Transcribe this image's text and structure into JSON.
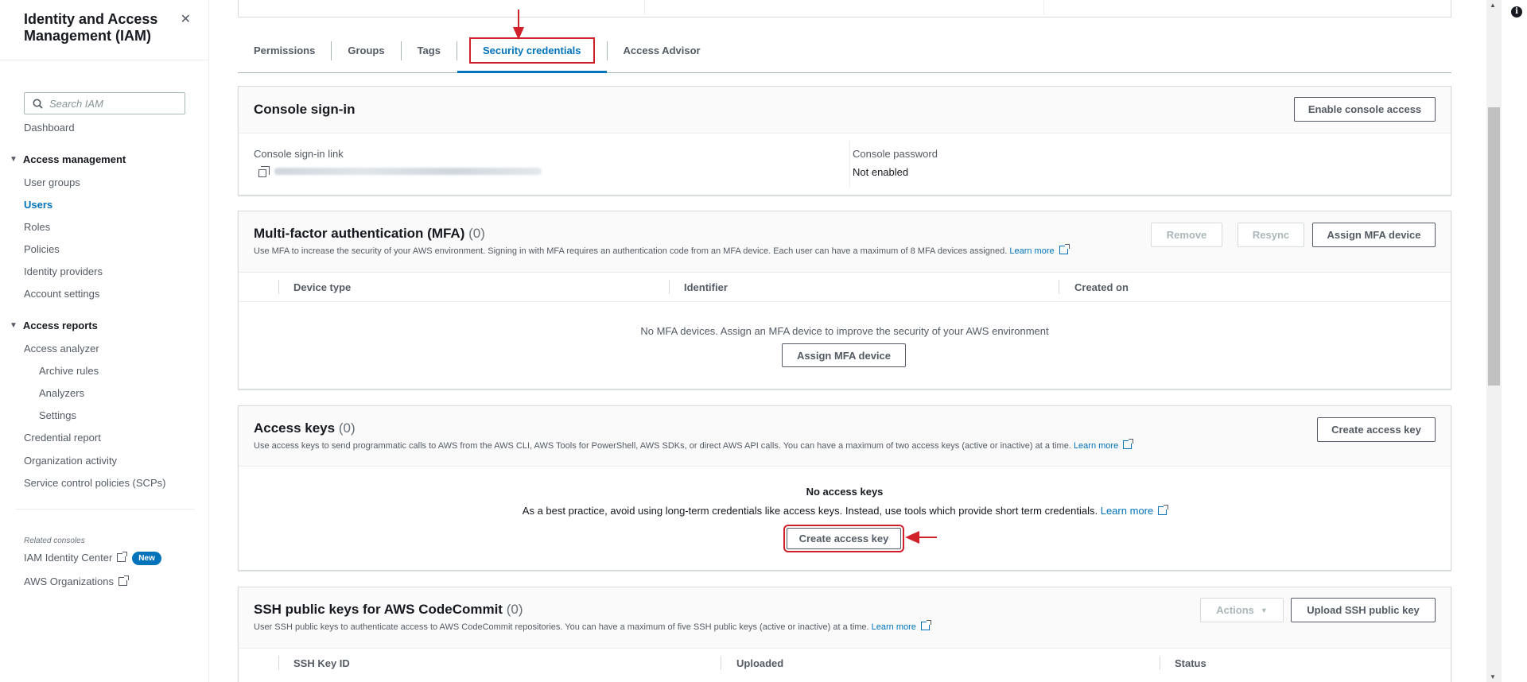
{
  "sidebar": {
    "title": "Identity and Access Management (IAM)",
    "search_placeholder": "Search IAM",
    "dashboard": "Dashboard",
    "access_management": {
      "label": "Access management",
      "items": [
        "User groups",
        "Users",
        "Roles",
        "Policies",
        "Identity providers",
        "Account settings"
      ],
      "active": "Users"
    },
    "access_reports": {
      "label": "Access reports",
      "analyzer": "Access analyzer",
      "analyzer_items": [
        "Archive rules",
        "Analyzers",
        "Settings"
      ],
      "items": [
        "Credential report",
        "Organization activity",
        "Service control policies (SCPs)"
      ]
    },
    "related_label": "Related consoles",
    "identity_center": "IAM Identity Center",
    "new_badge": "New",
    "organizations": "AWS Organizations"
  },
  "tabs": [
    {
      "label": "Permissions",
      "active": false
    },
    {
      "label": "Groups",
      "active": false
    },
    {
      "label": "Tags",
      "active": false
    },
    {
      "label": "Security credentials",
      "active": true
    },
    {
      "label": "Access Advisor",
      "active": false
    }
  ],
  "console_signin": {
    "title": "Console sign-in",
    "enable_button": "Enable console access",
    "link_label": "Console sign-in link",
    "password_label": "Console password",
    "password_value": "Not enabled"
  },
  "mfa": {
    "title": "Multi-factor authentication (MFA)",
    "count": "(0)",
    "description": "Use MFA to increase the security of your AWS environment. Signing in with MFA requires an authentication code from an MFA device. Each user can have a maximum of 8 MFA devices assigned.",
    "learn_more": "Learn more",
    "remove_button": "Remove",
    "resync_button": "Resync",
    "assign_button": "Assign MFA device",
    "columns": [
      "Device type",
      "Identifier",
      "Created on"
    ],
    "empty_text": "No MFA devices. Assign an MFA device to improve the security of your AWS environment",
    "empty_button": "Assign MFA device"
  },
  "access_keys": {
    "title": "Access keys",
    "count": "(0)",
    "description": "Use access keys to send programmatic calls to AWS from the AWS CLI, AWS Tools for PowerShell, AWS SDKs, or direct AWS API calls. You can have a maximum of two access keys (active or inactive) at a time.",
    "learn_more": "Learn more",
    "create_button": "Create access key",
    "empty_title": "No access keys",
    "empty_text": "As a best practice, avoid using long-term credentials like access keys. Instead, use tools which provide short term credentials.",
    "empty_learn_more": "Learn more",
    "empty_button": "Create access key"
  },
  "ssh": {
    "title": "SSH public keys for AWS CodeCommit",
    "count": "(0)",
    "description": "User SSH public keys to authenticate access to AWS CodeCommit repositories. You can have a maximum of five SSH public keys (active or inactive) at a time.",
    "learn_more": "Learn more",
    "actions_button": "Actions",
    "upload_button": "Upload SSH public key",
    "columns": [
      "SSH Key ID",
      "Uploaded",
      "Status"
    ]
  },
  "info_icon": "i",
  "colors": {
    "link": "#0073bb",
    "annotation_red": "#d0202a",
    "text": "#16191f",
    "muted": "#545b64"
  }
}
